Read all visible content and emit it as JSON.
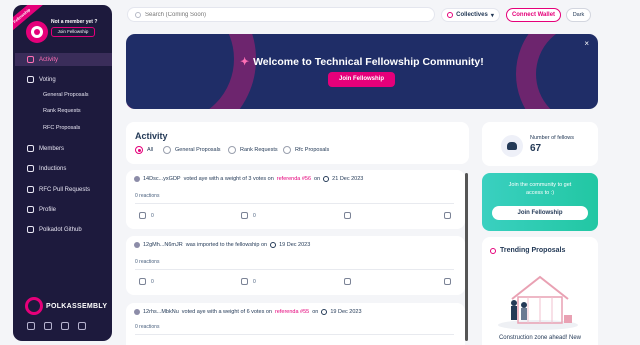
{
  "sidebar": {
    "ribbon": "Fellowship",
    "member_question": "Not a member yet ?",
    "join_button": "Join Fellowship",
    "nav": [
      {
        "label": "Activity",
        "icon": "home-icon",
        "active": true
      },
      {
        "label": "Voting",
        "icon": "ballot-icon"
      },
      {
        "label": "Members",
        "icon": "users-icon"
      },
      {
        "label": "Inductions",
        "icon": "inductions-icon"
      },
      {
        "label": "RFC Pull Requests",
        "icon": "pull-request-icon"
      },
      {
        "label": "Profile",
        "icon": "profile-icon"
      },
      {
        "label": "Polkadot Github",
        "icon": "github-icon"
      }
    ],
    "voting_sub": [
      "General Proposals",
      "Rank Requests",
      "RFC Proposals"
    ],
    "brand": "POLKASSEMBLY",
    "socials": [
      "twitter-icon",
      "discord-icon",
      "telegram-icon",
      "globe-icon"
    ]
  },
  "header": {
    "search_placeholder": "Search (Coming Soon)",
    "collectives": "Collectives",
    "connect_wallet": "Connect Wallet",
    "theme": "Dark"
  },
  "banner": {
    "title": "Welcome to Technical Fellowship Community!",
    "button": "Join Fellowship",
    "close": "×"
  },
  "activity": {
    "title": "Activity",
    "filters": [
      "All",
      "General Proposals",
      "Rank Requests",
      "Rfc Proposals"
    ],
    "selected_filter": "All",
    "feed": [
      {
        "user": "14Dsc...yxGDP",
        "pre": "voted aye with a weight of 3 votes on",
        "link": "referenda #56",
        "on": "on",
        "date": "21 Dec 2023",
        "reactions": "0 reactions",
        "likes": "0",
        "dislikes": "0"
      },
      {
        "user": "12gMh...N6mJR",
        "pre": "was imported to the fellowship on",
        "link": "",
        "on": "",
        "date": "19 Dec 2023",
        "reactions": "0 reactions",
        "likes": "0",
        "dislikes": "0"
      },
      {
        "user": "12rhs...MbkNu",
        "pre": "voted aye with a weight of 6 votes on",
        "link": "referenda #55",
        "on": "on",
        "date": "19 Dec 2023",
        "reactions": "0 reactions",
        "likes": "",
        "dislikes": ""
      }
    ]
  },
  "fellows": {
    "label": "Number of fellows",
    "count": "67"
  },
  "join_card": {
    "line1": "Join the community to get",
    "line2": "access to :)",
    "button": "Join Fellowship"
  },
  "trending": {
    "title": "Trending Proposals",
    "footer": "Construction zone ahead! New"
  }
}
